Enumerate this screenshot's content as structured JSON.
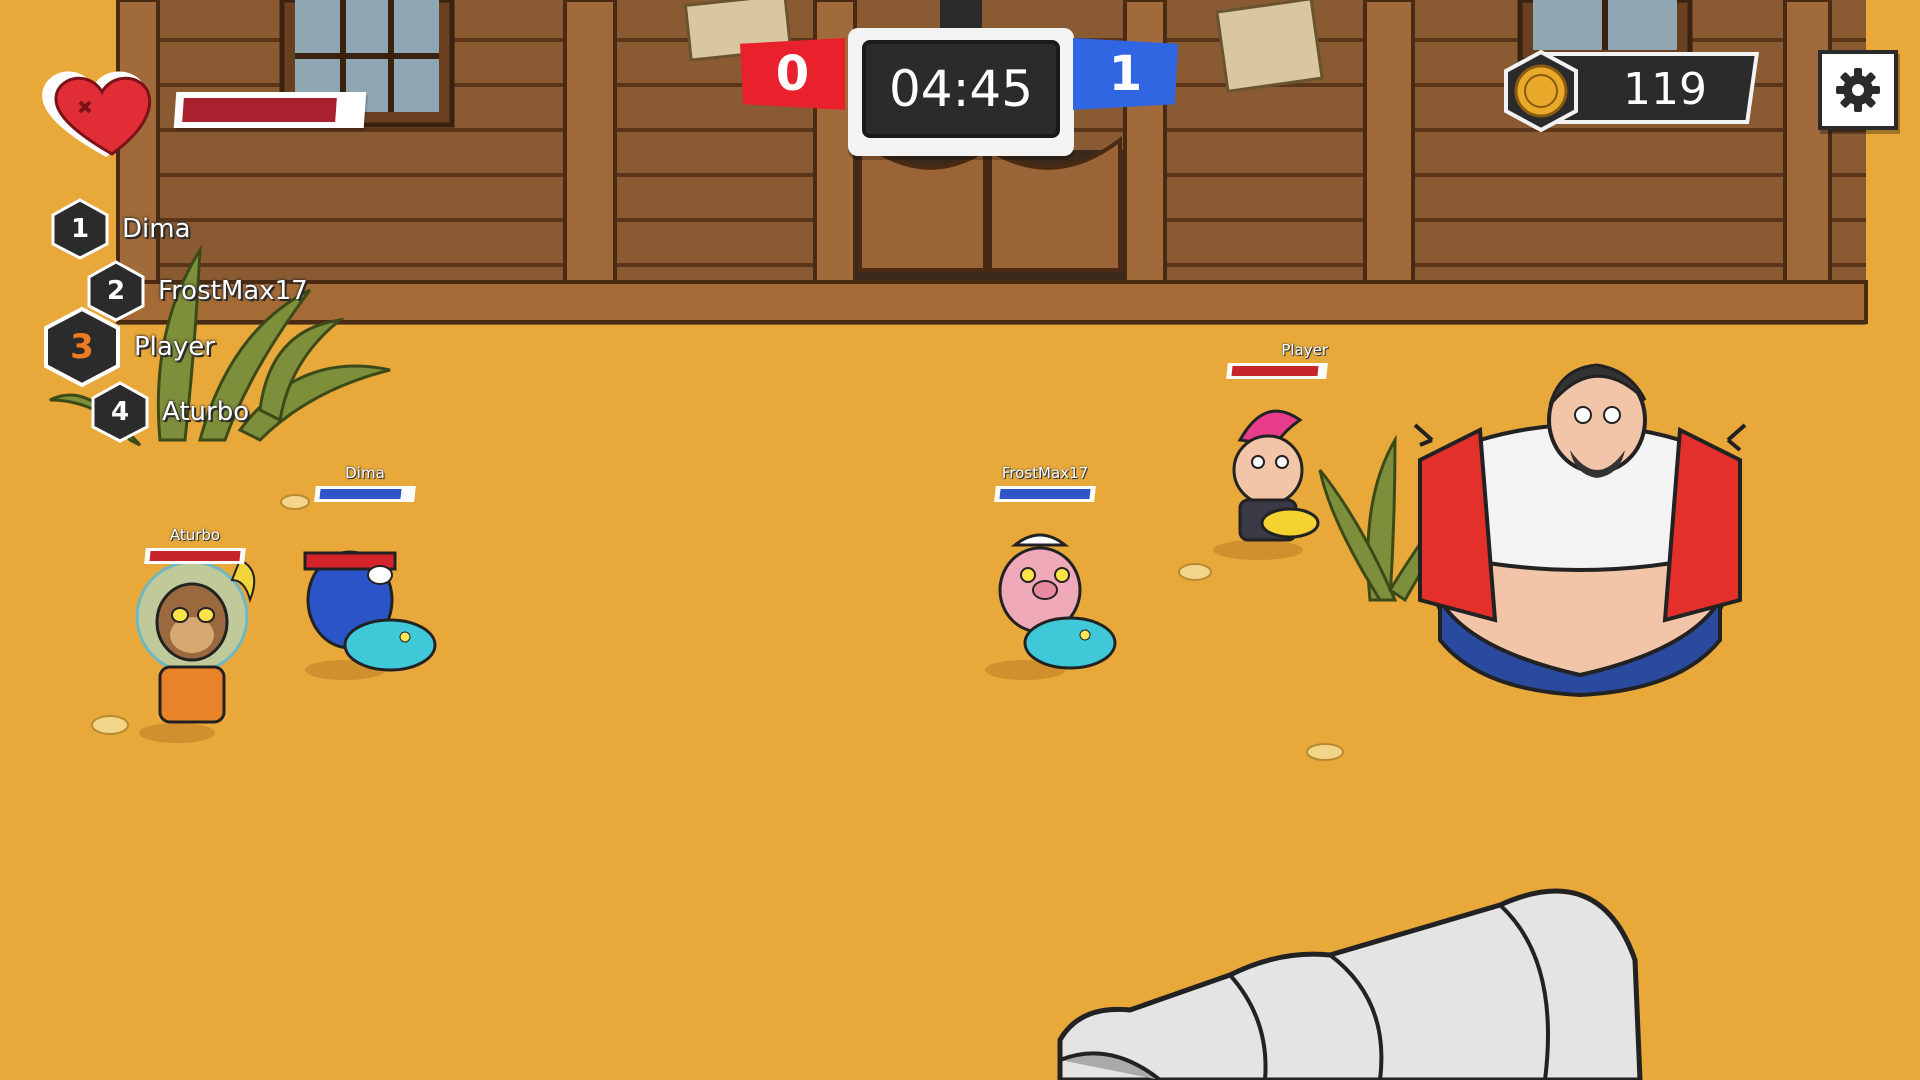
{
  "hud": {
    "health_fraction": 0.88,
    "score_red": "0",
    "score_blue": "1",
    "timer": "04:45",
    "coins": "119",
    "colors": {
      "red_team": "#e8212c",
      "blue_team": "#3166e3",
      "health": "#a9212e",
      "sand": "#e8a93a"
    }
  },
  "leaderboard": [
    {
      "rank": "1",
      "name": "Dima",
      "highlight": false
    },
    {
      "rank": "2",
      "name": "FrostMax17",
      "highlight": false
    },
    {
      "rank": "3",
      "name": "Player",
      "highlight": true
    },
    {
      "rank": "4",
      "name": "Aturbo",
      "highlight": false
    }
  ],
  "players": [
    {
      "name": "Dima",
      "team": "blue",
      "health_fraction": 0.9
    },
    {
      "name": "Aturbo",
      "team": "red",
      "health_fraction": 1.0
    },
    {
      "name": "FrostMax17",
      "team": "blue",
      "health_fraction": 1.0
    },
    {
      "name": "Player",
      "team": "red",
      "health_fraction": 0.95
    }
  ],
  "icons": {
    "heart": "heart-icon",
    "coin": "coin-icon",
    "settings": "gear-icon"
  }
}
